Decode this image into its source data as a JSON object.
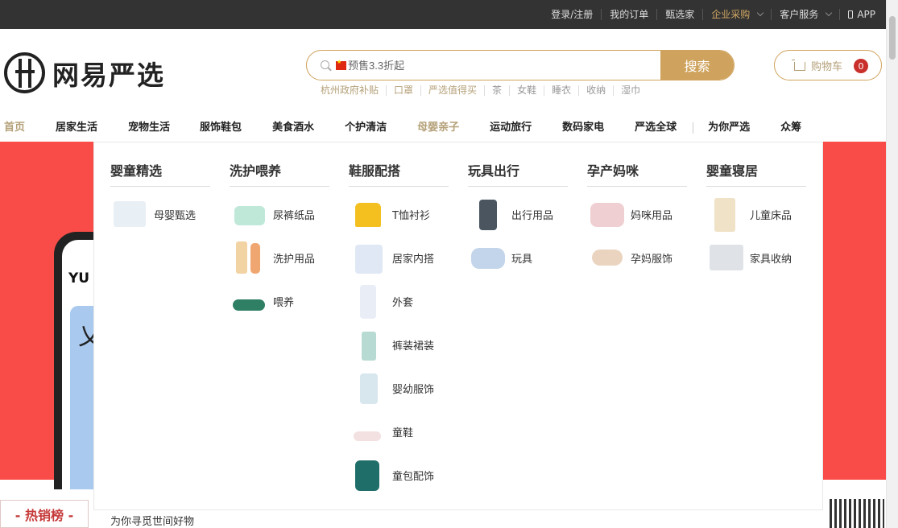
{
  "topbar": {
    "login": "登录/注册",
    "orders": "我的订单",
    "zhenxuanjia": "甄选家",
    "enterprise": "企业采购",
    "service": "客户服务",
    "app": "APP"
  },
  "brand": {
    "name": "网易严选"
  },
  "search": {
    "placeholder": "预售3.3折起",
    "button": "搜索",
    "hotwords": [
      "杭州政府补贴",
      "口罩",
      "严选值得买",
      "茶",
      "女鞋",
      "睡衣",
      "收纳",
      "湿巾"
    ]
  },
  "cart": {
    "label": "购物车",
    "count": "0"
  },
  "nav": [
    "首页",
    "居家生活",
    "宠物生活",
    "服饰鞋包",
    "美食酒水",
    "个护清洁",
    "母婴亲子",
    "运动旅行",
    "数码家电",
    "严选全球",
    "为你严选",
    "众筹"
  ],
  "nav_active": "母婴亲子",
  "dropdown": {
    "columns": [
      {
        "title": "婴童精选",
        "items": [
          "母婴甄选"
        ]
      },
      {
        "title": "洗护喂养",
        "items": [
          "尿裤纸品",
          "洗护用品",
          "喂养"
        ]
      },
      {
        "title": "鞋服配搭",
        "items": [
          "T恤衬衫",
          "居家内搭",
          "外套",
          "裤装裙装",
          "婴幼服饰",
          "童鞋",
          "童包配饰"
        ]
      },
      {
        "title": "玩具出行",
        "items": [
          "出行用品",
          "玩具"
        ]
      },
      {
        "title": "孕产妈咪",
        "items": [
          "妈咪用品",
          "孕妈服饰"
        ]
      },
      {
        "title": "婴童寝居",
        "items": [
          "儿童床品",
          "家具收纳"
        ]
      }
    ]
  },
  "banner": {
    "phone_text": "YU",
    "phone_char": "乂"
  },
  "slogan": "为你寻觅世间好物",
  "hotlist": "- 热销榜 -",
  "colors": {
    "gold": "#cfa35d",
    "banner_red": "#f94c48",
    "topbar": "#333333"
  }
}
